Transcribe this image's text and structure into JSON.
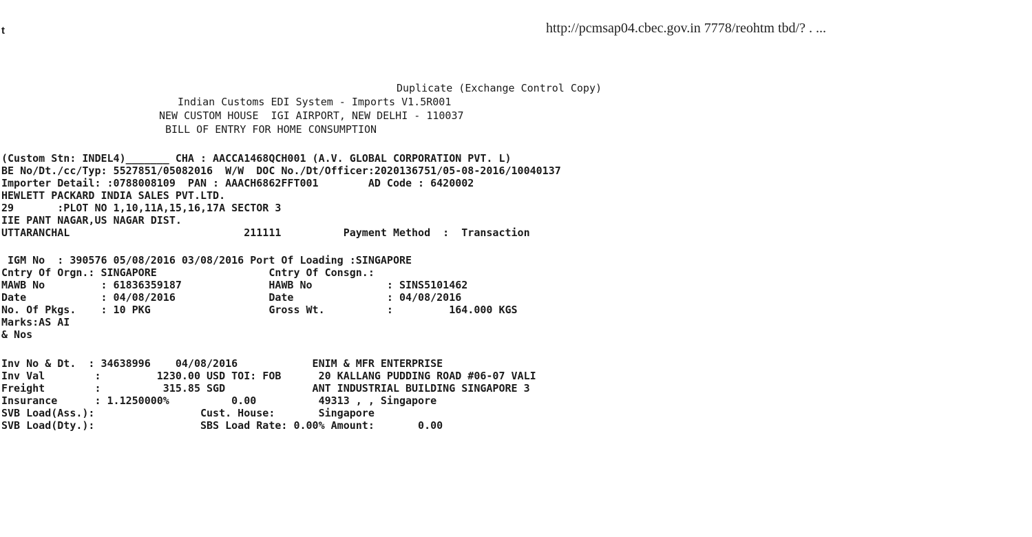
{
  "browser": {
    "corner_mark": "t",
    "url": "http://pcmsap04.cbec.gov.in 7778/reohtm tbd/? . ..."
  },
  "header": {
    "copy_type": "Duplicate (Exchange Control Copy)",
    "system": "Indian Customs EDI System - Imports V1.5R001",
    "custom_house": "NEW CUSTOM HOUSE  IGI AIRPORT, NEW DELHI - 110037",
    "document_title": "BILL OF ENTRY FOR HOME CONSUMPTION"
  },
  "entry": {
    "line1": "(Custom Stn: INDEL4)_______ CHA : AACCA1468QCH001 (A.V. GLOBAL CORPORATION PVT. L)",
    "line2": "BE No/Dt./cc/Typ: 5527851/05082016  W/W  DOC No./Dt/Officer:2020136751/05-08-2016/10040137",
    "line3": "Importer Detail: :0788008109  PAN : AAACH6862FFT001        AD Code : 6420002",
    "line4": "HEWLETT PACKARD INDIA SALES PVT.LTD.",
    "line5": "29       :PLOT NO 1,10,11A,15,16,17A SECTOR 3",
    "line6": "IIE PANT NAGAR,US NAGAR DIST.",
    "line7": "UTTARANCHAL                            211111          Payment Method  :  Transaction"
  },
  "shipment": {
    "line1": " IGM No  : 390576 05/08/2016 03/08/2016 Port Of Loading :SINGAPORE",
    "line2": "Cntry Of Orgn.: SINGAPORE                  Cntry Of Consgn.:",
    "line3": "MAWB No         : 61836359187              HAWB No            : SINS5101462",
    "line4": "Date            : 04/08/2016               Date               : 04/08/2016",
    "line5": "No. Of Pkgs.    : 10 PKG                   Gross Wt.          :         164.000 KGS",
    "line6": "Marks:AS AI",
    "line7": "& Nos"
  },
  "invoice": {
    "line1": "Inv No & Dt.  : 34638996    04/08/2016            ENIM & MFR ENTERPRISE",
    "line2": "Inv Val        :         1230.00 USD TOI: FOB      20 KALLANG PUDDING ROAD #06-07 VALI",
    "line3": "Freight        :          315.85 SGD              ANT INDUSTRIAL BUILDING SINGAPORE 3",
    "line4": "Insurance      : 1.1250000%          0.00          49313 , , Singapore",
    "line5": "SVB Load(Ass.):                 Cust. House:       Singapore",
    "line6": "SVB Load(Dty.):                 SBS Load Rate: 0.00% Amount:       0.00"
  }
}
